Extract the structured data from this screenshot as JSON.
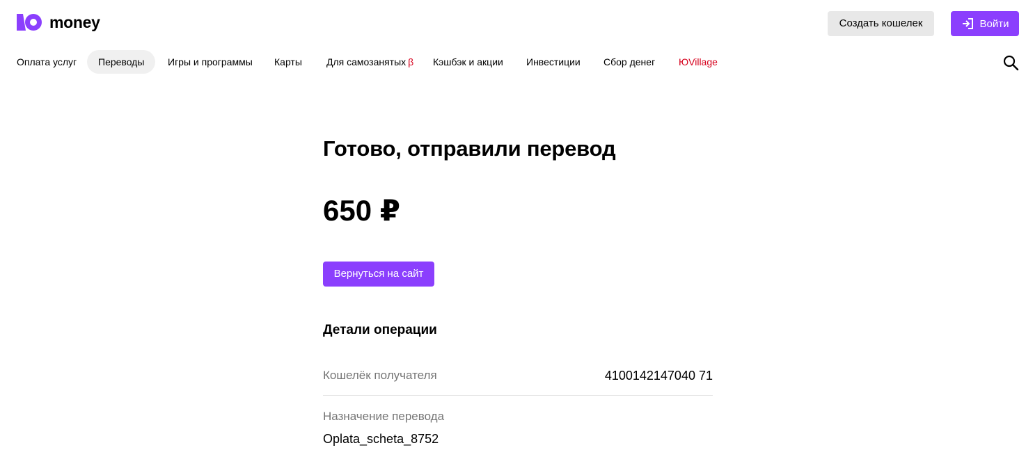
{
  "header": {
    "logo_text": "money",
    "create_wallet_label": "Создать кошелек",
    "login_label": "Войти"
  },
  "nav": {
    "items": [
      {
        "label": "Оплата услуг"
      },
      {
        "label": "Переводы",
        "active": true
      },
      {
        "label": "Игры и программы"
      },
      {
        "label": "Карты"
      },
      {
        "label": "Для самозанятых",
        "badge": "β"
      },
      {
        "label": "Кэшбэк и акции"
      },
      {
        "label": "Инвестиции"
      },
      {
        "label": "Сбор денег"
      },
      {
        "label": "ЮVillage"
      }
    ]
  },
  "icons": {
    "logo": "yoomoney-logo-icon",
    "login": "login-arrow-icon",
    "search": "search-icon"
  },
  "colors": {
    "brand": "#8b3ffd",
    "accent_red": "#d6001c",
    "muted": "#757575"
  },
  "main": {
    "title": "Готово, отправили перевод",
    "amount": "650 ₽",
    "back_button_label": "Вернуться на сайт",
    "details_title": "Детали операции",
    "details": [
      {
        "label": "Кошелёк получателя",
        "value": "4100142147040 71"
      },
      {
        "label": "Назначение перевода",
        "value": "Oplata_scheta_8752"
      }
    ]
  }
}
